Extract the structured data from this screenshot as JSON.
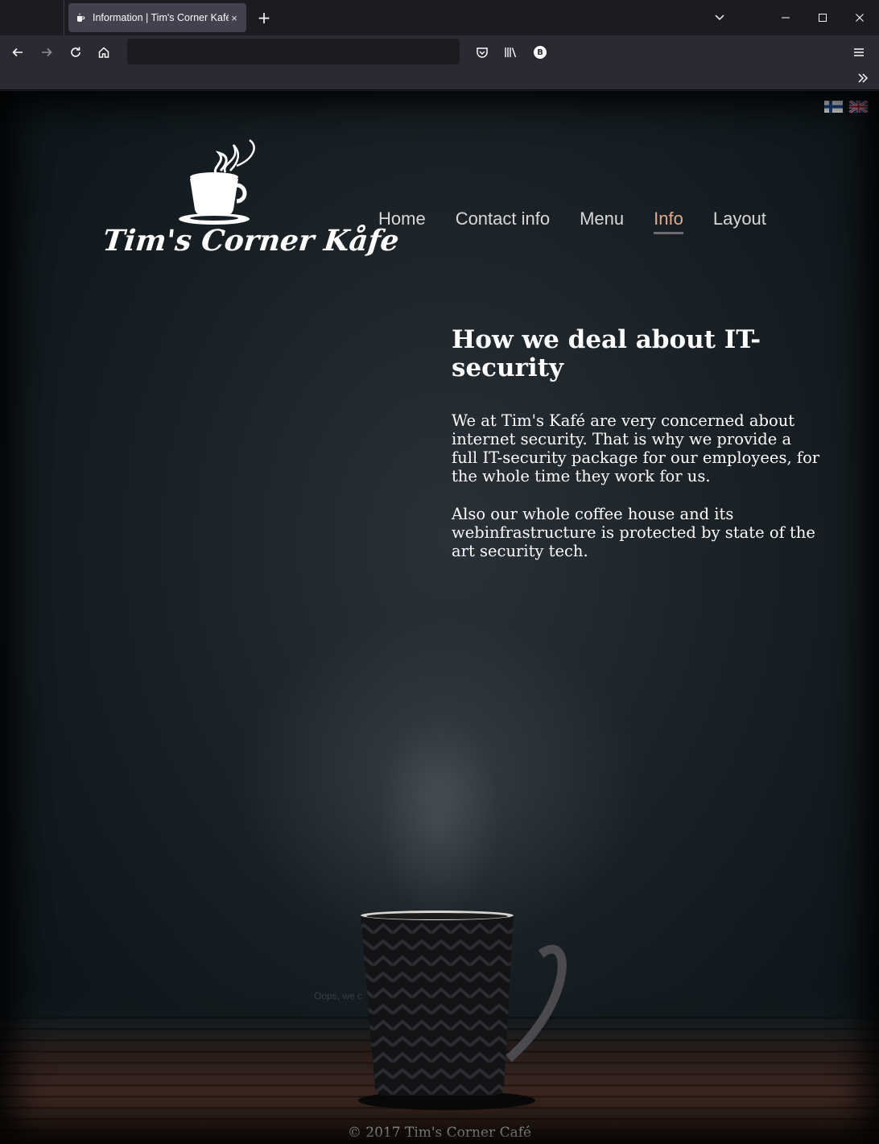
{
  "browser": {
    "tab_title": "Information | Tim's Corner Kafé",
    "new_tab_symbol": "+",
    "close_tab_symbol": "×",
    "icons": [
      "back-icon",
      "forward-icon",
      "reload-icon",
      "home-icon",
      "pocket-icon",
      "library-icon",
      "extension-icon",
      "menu-icon",
      "chevron-down-icon",
      "minimize-icon",
      "maximize-icon",
      "close-icon",
      "overflow-icon"
    ],
    "extension_badge": "B"
  },
  "page": {
    "languages": [
      "Finnish",
      "English"
    ],
    "logo_text": "Tim's Corner Kåfe",
    "nav": {
      "items": [
        "Home",
        "Contact info",
        "Menu",
        "Info",
        "Layout"
      ],
      "active": "Info"
    },
    "heading": "How we deal about IT-security",
    "paragraphs": [
      "We at Tim's Kafé are very concerned about internet security. That is why we provide a full IT-security package for our employees, for the whole time they work for us.",
      "Also our whole coffee house and its webinfrastructure is protected by state of the art security tech."
    ],
    "ghost_text": "Oops, we c",
    "footer": "© 2017 Tim's Corner Café"
  },
  "colors": {
    "nav_active": "#e2a98a",
    "nav_text": "#d8d8d8",
    "page_bg": "#182025"
  }
}
